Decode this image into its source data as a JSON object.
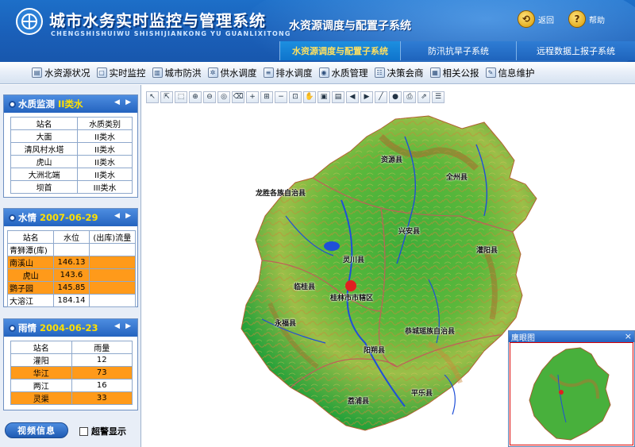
{
  "header": {
    "title": "城市水务实时监控与管理系统",
    "subtitle": "CHENGSHISHUIWU SHISHIJIANKONG YU GUANLIXITONG",
    "subsystem_title": "水资源调度与配置子系统",
    "back_label": "返回",
    "help_label": "帮助"
  },
  "tabs": [
    {
      "label": "水资源调度与配置子系统"
    },
    {
      "label": "防汛抗旱子系统"
    },
    {
      "label": "远程数据上报子系统"
    }
  ],
  "menu": [
    {
      "label": "水资源状况"
    },
    {
      "label": "实时监控"
    },
    {
      "label": "城市防洪"
    },
    {
      "label": "供水调度"
    },
    {
      "label": "排水调度"
    },
    {
      "label": "水质管理"
    },
    {
      "label": "决策会商"
    },
    {
      "label": "相关公报"
    },
    {
      "label": "信息维护"
    }
  ],
  "quality_panel": {
    "title": "水质监测",
    "accent": "II类水",
    "headers": [
      "站名",
      "水质类别"
    ],
    "rows": [
      [
        "大面",
        "II类水"
      ],
      [
        "清风村水塔",
        "II类水"
      ],
      [
        "虎山",
        "II类水"
      ],
      [
        "大洲北端",
        "II类水"
      ],
      [
        "坝首",
        "III类水"
      ]
    ]
  },
  "water_panel": {
    "title": "水情",
    "accent": "2007-06-29",
    "headers": [
      "站名",
      "水位",
      "(出库)流量"
    ],
    "rows": [
      [
        "青狮潭(库)",
        "",
        ""
      ],
      [
        "南溪山",
        "146.13",
        ""
      ],
      [
        "虎山",
        "143.6",
        ""
      ],
      [
        "鹦子园",
        "145.85",
        ""
      ],
      [
        "大溶江",
        "184.14",
        ""
      ]
    ],
    "highlighted": [
      1,
      2,
      3
    ]
  },
  "rain_panel": {
    "title": "雨情",
    "accent": "2004-06-23",
    "headers": [
      "站名",
      "雨量"
    ],
    "rows": [
      [
        "灌阳",
        "12"
      ],
      [
        "华江",
        "73"
      ],
      [
        "两江",
        "16"
      ],
      [
        "灵渠",
        "33"
      ]
    ],
    "highlighted": [
      1,
      3
    ]
  },
  "sidebar_bottom": {
    "video_label": "视频信息",
    "alarm_label": "超警显示"
  },
  "map": {
    "places": [
      "资源县",
      "全州县",
      "龙胜各族自治县",
      "兴安县",
      "灌阳县",
      "灵川县",
      "临桂县",
      "桂林市市辖区",
      "永福县",
      "恭城瑶族自治县",
      "阳朔县",
      "荔浦县",
      "平乐县"
    ]
  },
  "overview": {
    "title": "鹰眼图",
    "close": "×"
  },
  "colors": {
    "header_blue": "#1a5fb8",
    "highlight_orange": "#ff9a1a",
    "accent_yellow": "#ffe000"
  }
}
